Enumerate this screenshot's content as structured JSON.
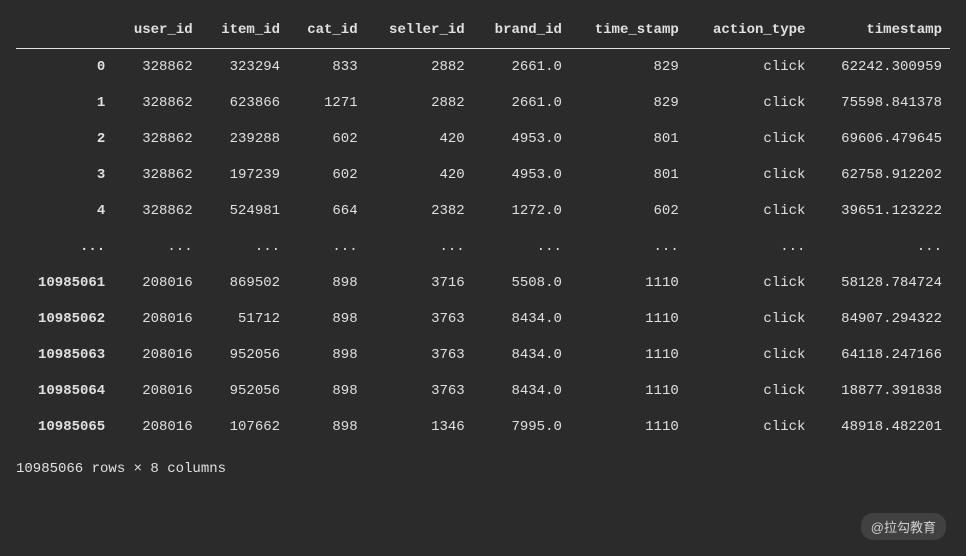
{
  "table": {
    "columns": [
      "user_id",
      "item_id",
      "cat_id",
      "seller_id",
      "brand_id",
      "time_stamp",
      "action_type",
      "timestamp"
    ],
    "rows": [
      {
        "index": "0",
        "user_id": "328862",
        "item_id": "323294",
        "cat_id": "833",
        "seller_id": "2882",
        "brand_id": "2661.0",
        "time_stamp": "829",
        "action_type": "click",
        "timestamp": "62242.300959"
      },
      {
        "index": "1",
        "user_id": "328862",
        "item_id": "623866",
        "cat_id": "1271",
        "seller_id": "2882",
        "brand_id": "2661.0",
        "time_stamp": "829",
        "action_type": "click",
        "timestamp": "75598.841378"
      },
      {
        "index": "2",
        "user_id": "328862",
        "item_id": "239288",
        "cat_id": "602",
        "seller_id": "420",
        "brand_id": "4953.0",
        "time_stamp": "801",
        "action_type": "click",
        "timestamp": "69606.479645"
      },
      {
        "index": "3",
        "user_id": "328862",
        "item_id": "197239",
        "cat_id": "602",
        "seller_id": "420",
        "brand_id": "4953.0",
        "time_stamp": "801",
        "action_type": "click",
        "timestamp": "62758.912202"
      },
      {
        "index": "4",
        "user_id": "328862",
        "item_id": "524981",
        "cat_id": "664",
        "seller_id": "2382",
        "brand_id": "1272.0",
        "time_stamp": "602",
        "action_type": "click",
        "timestamp": "39651.123222"
      },
      {
        "index": "...",
        "user_id": "...",
        "item_id": "...",
        "cat_id": "...",
        "seller_id": "...",
        "brand_id": "...",
        "time_stamp": "...",
        "action_type": "...",
        "timestamp": "..."
      },
      {
        "index": "10985061",
        "user_id": "208016",
        "item_id": "869502",
        "cat_id": "898",
        "seller_id": "3716",
        "brand_id": "5508.0",
        "time_stamp": "1110",
        "action_type": "click",
        "timestamp": "58128.784724"
      },
      {
        "index": "10985062",
        "user_id": "208016",
        "item_id": "51712",
        "cat_id": "898",
        "seller_id": "3763",
        "brand_id": "8434.0",
        "time_stamp": "1110",
        "action_type": "click",
        "timestamp": "84907.294322"
      },
      {
        "index": "10985063",
        "user_id": "208016",
        "item_id": "952056",
        "cat_id": "898",
        "seller_id": "3763",
        "brand_id": "8434.0",
        "time_stamp": "1110",
        "action_type": "click",
        "timestamp": "64118.247166"
      },
      {
        "index": "10985064",
        "user_id": "208016",
        "item_id": "952056",
        "cat_id": "898",
        "seller_id": "3763",
        "brand_id": "8434.0",
        "time_stamp": "1110",
        "action_type": "click",
        "timestamp": "18877.391838"
      },
      {
        "index": "10985065",
        "user_id": "208016",
        "item_id": "107662",
        "cat_id": "898",
        "seller_id": "1346",
        "brand_id": "7995.0",
        "time_stamp": "1110",
        "action_type": "click",
        "timestamp": "48918.482201"
      }
    ],
    "summary": "10985066 rows × 8 columns"
  },
  "watermark": "@拉勾教育"
}
